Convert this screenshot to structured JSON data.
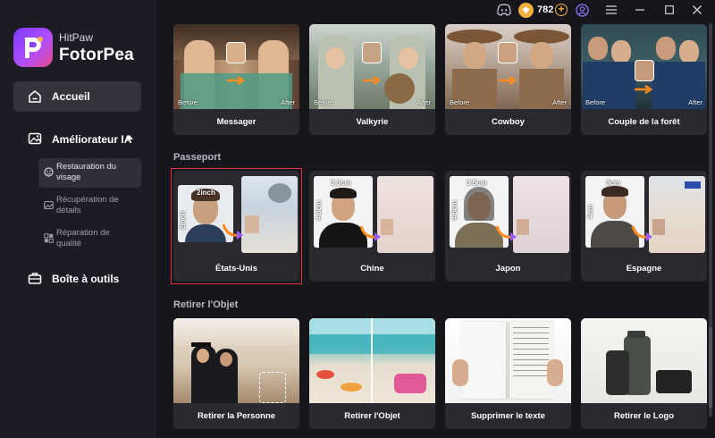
{
  "brand": {
    "line1": "HitPaw",
    "line2": "FotorPea"
  },
  "sidebar": {
    "home": "Accueil",
    "enhancer": "Améliorateur IA",
    "subitems": [
      {
        "label_lines": [
          "Restauration du",
          "visage"
        ],
        "active": true
      },
      {
        "label_lines": [
          "Récupération de",
          "détails"
        ],
        "active": false
      },
      {
        "label_lines": [
          "Réparation de",
          "qualité"
        ],
        "active": false
      }
    ],
    "tools": "Boîte à outils"
  },
  "topbar": {
    "coins": "782"
  },
  "sections": {
    "face_swap": {
      "cards": [
        {
          "label": "Messager",
          "before": "Before",
          "after": "After"
        },
        {
          "label": "Valkyrie",
          "before": "Before",
          "after": "After"
        },
        {
          "label": "Cowboy",
          "before": "Before",
          "after": "After"
        },
        {
          "label": "Couple de la forêt",
          "before": "Before",
          "after": "After"
        }
      ]
    },
    "passport": {
      "title": "Passeport",
      "cards": [
        {
          "label": "États-Unis",
          "w": "2inch",
          "h": "2inch",
          "selected": true
        },
        {
          "label": "Chine",
          "w": "3.3cm",
          "h": "4.8cm",
          "selected": false
        },
        {
          "label": "Japon",
          "w": "3.5cm",
          "h": "4.5cm",
          "selected": false
        },
        {
          "label": "Espagne",
          "w": "3cm",
          "h": "4cm",
          "selected": false
        }
      ]
    },
    "remove": {
      "title": "Retirer l'Objet",
      "cards": [
        {
          "label": "Retirer la Personne"
        },
        {
          "label": "Retirer l'Objet"
        },
        {
          "label": "Supprimer le texte"
        },
        {
          "label": "Retirer le Logo"
        }
      ]
    }
  },
  "colors": {
    "accent": "#7a3cff",
    "selected_border": "#e0343b",
    "coin": "#f2b13a"
  }
}
